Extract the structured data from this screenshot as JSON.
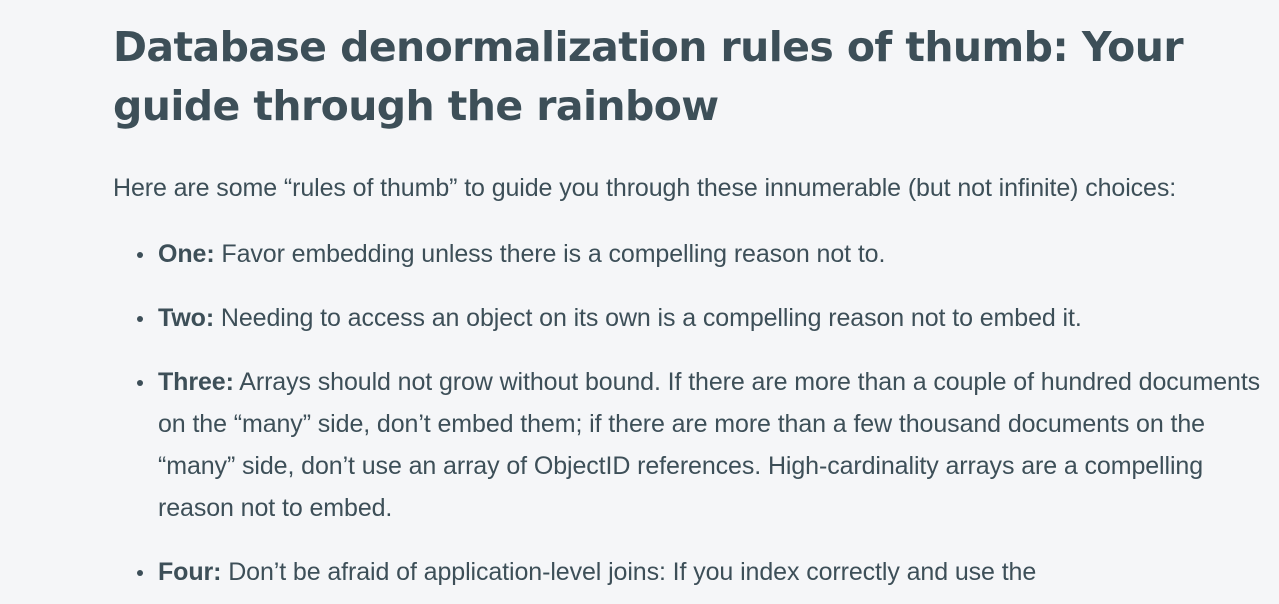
{
  "article": {
    "title": "Database denormalization rules of thumb: Your guide through the rainbow",
    "intro": "Here are some “rules of thumb” to guide you through these innumerable (but not infinite) choices:",
    "rules": [
      {
        "label": "One:",
        "text": " Favor embedding unless there is a compelling reason not to."
      },
      {
        "label": "Two:",
        "text": " Needing to access an object on its own is a compelling reason not to embed it."
      },
      {
        "label": "Three:",
        "text": " Arrays should not grow without bound. If there are more than a couple of hundred documents on the “many” side, don’t embed them; if there are more than a few thousand documents on the “many” side, don’t use an array of ObjectID references. High-cardinality arrays are a compelling reason not to embed."
      },
      {
        "label": "Four:",
        "text": " Don’t be afraid of application-level joins: If you index correctly and use the"
      }
    ]
  }
}
